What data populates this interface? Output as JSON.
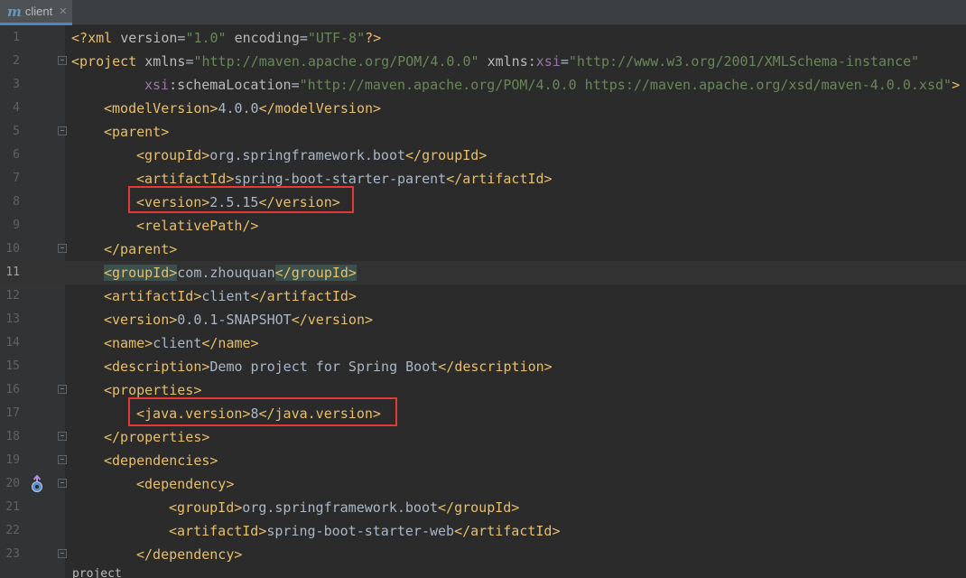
{
  "tab": {
    "icon": "maven-icon",
    "glyph": "m",
    "label": "client",
    "close_glyph": "✕"
  },
  "lines": [
    {
      "n": "1",
      "pi_open": "<?",
      "pi_name": "xml",
      "a1": "version",
      "v1": "\"1.0\"",
      "a2": "encoding",
      "v2": "\"UTF-8\"",
      "pi_close": "?>"
    },
    {
      "n": "2",
      "lt": "<",
      "tag": "project",
      "a1": "xmlns",
      "v1": "\"http://maven.apache.org/POM/4.0.0\"",
      "a2p": "xmlns",
      "a2ns": "xsi",
      "v2": "\"http://www.w3.org/2001/XMLSchema-instance\""
    },
    {
      "n": "3",
      "ns": "xsi",
      "attr": "schemaLocation",
      "val": "\"http://maven.apache.org/POM/4.0.0 https://maven.apache.org/xsd/maven-4.0.0.xsd\"",
      "gt": ">"
    },
    {
      "n": "4",
      "open": "<modelVersion>",
      "text": "4.0.0",
      "close": "</modelVersion>"
    },
    {
      "n": "5",
      "open": "<parent>"
    },
    {
      "n": "6",
      "open": "<groupId>",
      "text": "org.springframework.boot",
      "close": "</groupId>"
    },
    {
      "n": "7",
      "open": "<artifactId>",
      "text": "spring-boot-starter-parent",
      "close": "</artifactId>"
    },
    {
      "n": "8",
      "open": "<version>",
      "text": "2.5.15",
      "close": "</version>"
    },
    {
      "n": "9",
      "open": "<relativePath/>"
    },
    {
      "n": "10",
      "open": "</parent>"
    },
    {
      "n": "11",
      "open": "<groupId>",
      "text": "com.zhouquan",
      "close": "</groupId>"
    },
    {
      "n": "12",
      "open": "<artifactId>",
      "text": "client",
      "close": "</artifactId>"
    },
    {
      "n": "13",
      "open": "<version>",
      "text": "0.0.1-SNAPSHOT",
      "close": "</version>"
    },
    {
      "n": "14",
      "open": "<name>",
      "text": "client",
      "close": "</name>"
    },
    {
      "n": "15",
      "open": "<description>",
      "text": "Demo project for Spring Boot",
      "close": "</description>"
    },
    {
      "n": "16",
      "open": "<properties>"
    },
    {
      "n": "17",
      "open": "<java.version>",
      "text": "8",
      "close": "</java.version>"
    },
    {
      "n": "18",
      "open": "</properties>"
    },
    {
      "n": "19",
      "open": "<dependencies>"
    },
    {
      "n": "20",
      "open": "<dependency>"
    },
    {
      "n": "21",
      "open": "<groupId>",
      "text": "org.springframework.boot",
      "close": "</groupId>"
    },
    {
      "n": "22",
      "open": "<artifactId>",
      "text": "spring-boot-starter-web",
      "close": "</artifactId>"
    },
    {
      "n": "23",
      "open": "</dependency>"
    }
  ],
  "breadcrumb": "project",
  "current_line": 11,
  "colors": {
    "background": "#2b2b2b",
    "gutter": "#313335",
    "tag": "#e8bf6a",
    "attr_value": "#6a8759",
    "namespace": "#9876aa",
    "text": "#a9b7c6",
    "highlight_box": "#e53935",
    "matched_tag": "#3b514d"
  }
}
